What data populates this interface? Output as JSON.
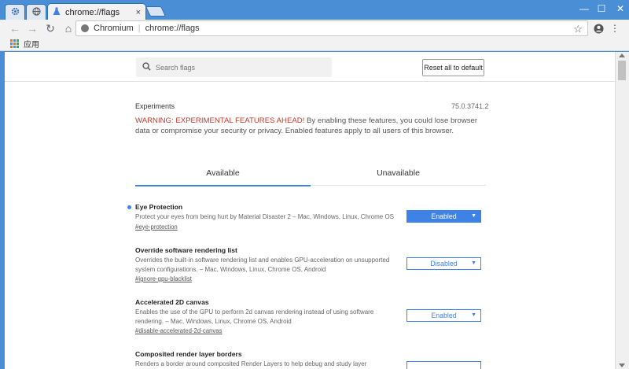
{
  "tabs": [
    {
      "icon": "gear-icon"
    },
    {
      "icon": "globe-icon"
    },
    {
      "title": "chrome://flags",
      "icon": "flask-icon",
      "close": "×"
    }
  ],
  "window": {
    "min": "—",
    "max": "☐",
    "close": "✕"
  },
  "toolbar": {
    "back": "←",
    "forward": "→",
    "reload": "↻",
    "home": "⌂",
    "site_name": "Chromium",
    "separator": "|",
    "url": "chrome://flags",
    "star": "☆",
    "menu": "⋮"
  },
  "bookmarks": {
    "apps_label": "应用"
  },
  "flags_page": {
    "search_placeholder": "Search flags",
    "reset_label": "Reset all to default",
    "experiments_title": "Experiments",
    "version": "75.0.3741.2",
    "warning_label": "WARNING: EXPERIMENTAL FEATURES AHEAD!",
    "warning_text": " By enabling these features, you could lose browser data or compromise your security or privacy. Enabled features apply to all users of this browser.",
    "tab_available": "Available",
    "tab_unavailable": "Unavailable",
    "flags": [
      {
        "name": "Eye Protection",
        "description": "Protect your eyes from being hurt by Material Disaster 2 – Mac, Windows, Linux, Chrome OS",
        "link": "#eye-protection",
        "state": "Enabled",
        "modified": true
      },
      {
        "name": "Override software rendering list",
        "description": "Overrides the built-in software rendering list and enables GPU-acceleration on unsupported system configurations. – Mac, Windows, Linux, Chrome OS, Android",
        "link": "#ignore-gpu-blacklist",
        "state": "Disabled",
        "modified": false
      },
      {
        "name": "Accelerated 2D canvas",
        "description": "Enables the use of the GPU to perform 2d canvas rendering instead of using software rendering. – Mac, Windows, Linux, Chrome OS, Android",
        "link": "#disable-accelerated-2d-canvas",
        "state": "Enabled",
        "modified": false
      },
      {
        "name": "Composited render layer borders",
        "description": "Renders a border around composited Render Layers to help debug and study layer composition. –",
        "link": "",
        "state": "",
        "modified": false
      }
    ]
  },
  "colors": {
    "titlebar": "#4a8fd6",
    "accent": "#3f82e5",
    "warning": "#c53929"
  }
}
